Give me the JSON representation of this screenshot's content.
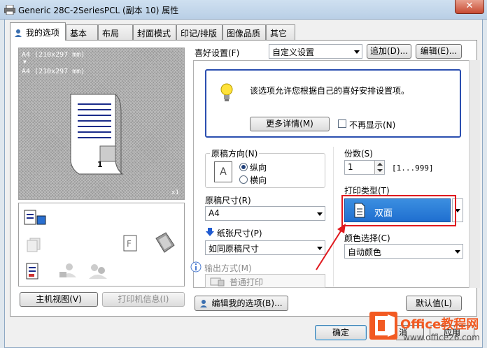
{
  "window": {
    "title": "Generic 28C-2SeriesPCL (副本 10) 属性",
    "close_glyph": "✕"
  },
  "tabs": [
    {
      "label": "我的选项",
      "active": true
    },
    {
      "label": "基本"
    },
    {
      "label": "布局"
    },
    {
      "label": "封面模式"
    },
    {
      "label": "印记/排版"
    },
    {
      "label": "图像品质"
    },
    {
      "label": "其它"
    }
  ],
  "preview": {
    "line1": "A4 (210x297 mm)",
    "arrow": "▼",
    "line2": "A4 (210x297 mm)",
    "page_number": "1",
    "copies_badge": "x1"
  },
  "favorite": {
    "label": "喜好设置(F)",
    "value": "自定义设置",
    "add_button": "追加(D)...",
    "edit_button": "编辑(E)..."
  },
  "info": {
    "text": "该选项允许您根据自己的喜好安排设置项。",
    "more_button": "更多详情(M)",
    "no_show_label": "不再显示(N)"
  },
  "orientation": {
    "group_label": "原稿方向(N)",
    "icon_letter": "A",
    "portrait": "纵向",
    "landscape": "横向"
  },
  "original_size": {
    "label": "原稿尺寸(R)",
    "value": "A4"
  },
  "paper_size": {
    "label": "纸张尺寸(P)",
    "value": "如同原稿尺寸"
  },
  "output": {
    "label": "输出方式(M)",
    "value": "普通打印"
  },
  "copies": {
    "label": "份数(S)",
    "value": "1",
    "range": "[1...999]"
  },
  "print_type": {
    "label": "打印类型(T)",
    "value": "双面"
  },
  "color": {
    "label": "颜色选择(C)",
    "value": "自动颜色"
  },
  "buttons": {
    "host_view": "主机视图(V)",
    "printer_info": "打印机信息(I)",
    "edit_my_options": "编辑我的选项(B)...",
    "default": "默认值(L)",
    "ok": "确定",
    "cancel_partial": "消",
    "apply_partial": "应用"
  },
  "watermark": {
    "brand": "Office教程网",
    "url": "www.office26.com"
  },
  "colors": {
    "accent_blue": "#1f6fd0",
    "highlight_red": "#e0191e",
    "info_border": "#2b4fb0"
  }
}
